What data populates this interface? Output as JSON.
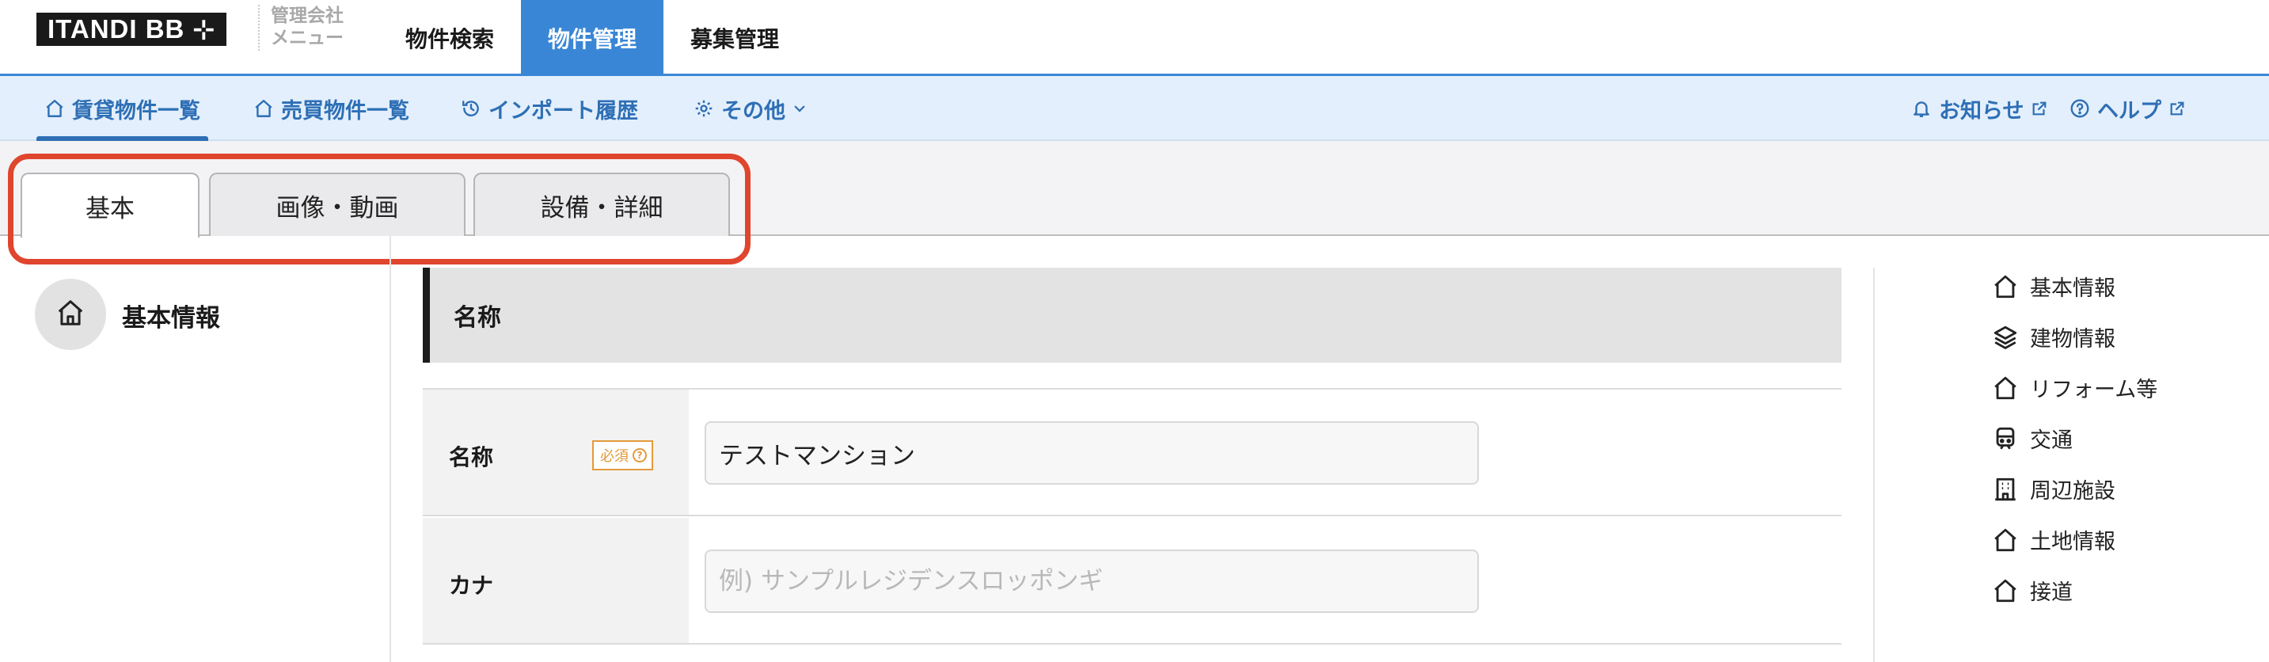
{
  "header": {
    "logo_text": "ITANDI BB ⊹",
    "company_menu_line1": "管理会社",
    "company_menu_line2": "メニュー",
    "nav": [
      {
        "label": "物件検索",
        "active": false
      },
      {
        "label": "物件管理",
        "active": true
      },
      {
        "label": "募集管理",
        "active": false
      }
    ],
    "accent_color": "#3a86d6"
  },
  "subnav": {
    "items": [
      {
        "label": "賃貸物件一覧",
        "icon": "home-icon",
        "active": true
      },
      {
        "label": "売買物件一覧",
        "icon": "home-icon",
        "active": false
      },
      {
        "label": "インポート履歴",
        "icon": "history-icon",
        "active": false
      },
      {
        "label": "その他",
        "icon": "gear-icon",
        "active": false
      }
    ],
    "notices_label": "お知らせ",
    "help_label": "ヘルプ"
  },
  "tabs": [
    {
      "label": "基本",
      "active": true
    },
    {
      "label": "画像・動画",
      "active": false
    },
    {
      "label": "設備・詳細",
      "active": false
    }
  ],
  "highlight_color": "#e0452d",
  "section": {
    "title": "基本情報",
    "icon": "home-icon"
  },
  "form": {
    "heading": "名称",
    "rows": [
      {
        "label": "名称",
        "required_label": "必須",
        "value": "テストマンション",
        "placeholder": ""
      },
      {
        "label": "カナ",
        "value": "",
        "placeholder": "例) サンプルレジデンスロッポンギ"
      }
    ]
  },
  "right_nav": [
    {
      "label": "基本情報",
      "icon": "home-icon"
    },
    {
      "label": "建物情報",
      "icon": "layers-icon"
    },
    {
      "label": "リフォーム等",
      "icon": "home-icon"
    },
    {
      "label": "交通",
      "icon": "train-icon"
    },
    {
      "label": "周辺施設",
      "icon": "building-icon"
    },
    {
      "label": "土地情報",
      "icon": "home-icon"
    },
    {
      "label": "接道",
      "icon": "home-icon"
    }
  ]
}
